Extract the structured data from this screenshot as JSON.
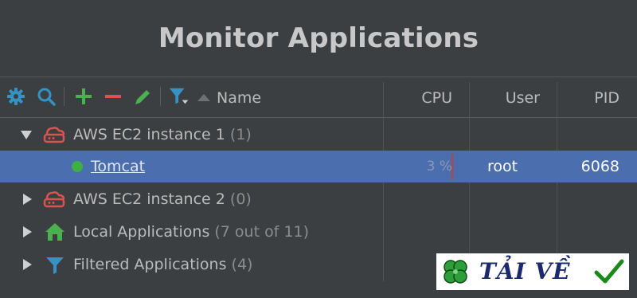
{
  "window": {
    "title": "Monitor Applications"
  },
  "toolbar": {
    "icons": [
      "gear-icon",
      "search-icon",
      "plus-icon",
      "minus-icon",
      "edit-icon",
      "filter-icon"
    ]
  },
  "columns": {
    "name": "Name",
    "cpu": "CPU",
    "user": "User",
    "pid": "PID",
    "sort": "ascending"
  },
  "tree": [
    {
      "label": "AWS EC2 instance 1",
      "count": "(1)",
      "expanded": true,
      "icon": "cloud-server-icon"
    },
    {
      "label": "Tomcat",
      "running": true,
      "cpu": "3 %",
      "cpu_percent": 3,
      "user": "root",
      "pid": "6068",
      "selected": true
    },
    {
      "label": "AWS EC2 instance 2",
      "count": "(0)",
      "expanded": false,
      "icon": "cloud-server-icon"
    },
    {
      "label": "Local Applications",
      "count": "(7 out of 11)",
      "expanded": false,
      "icon": "home-icon"
    },
    {
      "label": "Filtered Applications",
      "count": "(4)",
      "expanded": false,
      "icon": "filter-icon"
    }
  ],
  "watermark": {
    "text": "TẢI VỀ"
  },
  "colors": {
    "background": "#3c3f41",
    "selection": "#4b6eaf",
    "cloud_icon": "#d9534f",
    "home_icon": "#4caf50",
    "filter_icon": "#3592c4",
    "running": "#3cb043"
  }
}
